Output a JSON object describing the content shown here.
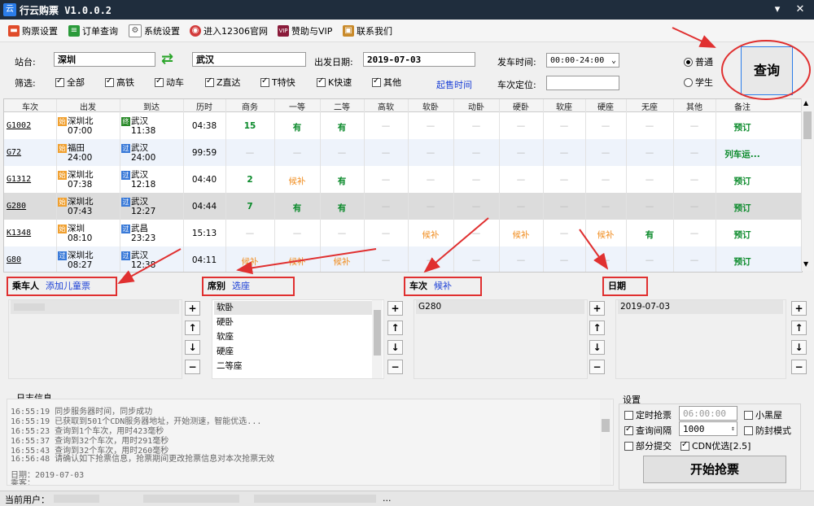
{
  "window": {
    "title": "行云购票 V1.0.0.2",
    "logo": "云",
    "min": "▾",
    "close": "✕"
  },
  "toolbar": [
    {
      "label": "购票设置",
      "icon": "ticket-icon",
      "color": "#e04b2a"
    },
    {
      "label": "订单查询",
      "icon": "order-icon",
      "color": "#2a9a3a"
    },
    {
      "label": "系统设置",
      "icon": "gear-icon",
      "color": "#666666"
    },
    {
      "label": "进入12306官网",
      "icon": "globe-icon",
      "color": "#d23a3a"
    },
    {
      "label": "赞助与VIP",
      "icon": "vip-icon",
      "color": "#8a1b3a"
    },
    {
      "label": "联系我们",
      "icon": "contact-icon",
      "color": "#c98a2a"
    }
  ],
  "search": {
    "station_label": "站台:",
    "from": "深圳",
    "to": "武汉",
    "swap_icon": "⇄",
    "date_label": "出发日期:",
    "date": "2019-07-03",
    "time_label": "发车时间:",
    "time": "00:00-24:00",
    "filter_label": "筛选:",
    "filters": [
      "全部",
      "高铁",
      "动车",
      "Z直达",
      "T特快",
      "K快速",
      "其他"
    ],
    "presale_link": "起售时间",
    "locate_label": "车次定位:",
    "mode_normal": "普通",
    "mode_student": "学生",
    "query_button": "查询"
  },
  "table": {
    "headers": [
      "车次",
      "出发",
      "到达",
      "历时",
      "商务",
      "一等",
      "二等",
      "高软",
      "软卧",
      "动卧",
      "硬卧",
      "软座",
      "硬座",
      "无座",
      "其他",
      "备注"
    ],
    "rows": [
      {
        "train": "G1002",
        "from_tag": "始",
        "from": "深圳北",
        "dep": "07:00",
        "to_tag": "终",
        "to": "武汉",
        "arr": "11:38",
        "dur": "04:38",
        "seats": [
          "15",
          "有",
          "有",
          "—",
          "—",
          "—",
          "—",
          "—",
          "—",
          "—",
          "—"
        ],
        "note": "预订"
      },
      {
        "train": "G72",
        "from_tag": "始",
        "from": "福田",
        "dep": "24:00",
        "to_tag": "过",
        "to": "武汉",
        "arr": "24:00",
        "dur": "99:59",
        "seats": [
          "—",
          "—",
          "—",
          "—",
          "—",
          "—",
          "—",
          "—",
          "—",
          "—",
          "—"
        ],
        "note": "列车运..."
      },
      {
        "train": "G1312",
        "from_tag": "始",
        "from": "深圳北",
        "dep": "07:38",
        "to_tag": "过",
        "to": "武汉",
        "arr": "12:18",
        "dur": "04:40",
        "seats": [
          "2",
          "候补",
          "有",
          "—",
          "—",
          "—",
          "—",
          "—",
          "—",
          "—",
          "—"
        ],
        "note": "预订"
      },
      {
        "train": "G280",
        "from_tag": "始",
        "from": "深圳北",
        "dep": "07:43",
        "to_tag": "过",
        "to": "武汉",
        "arr": "12:27",
        "dur": "04:44",
        "seats": [
          "7",
          "有",
          "有",
          "—",
          "—",
          "—",
          "—",
          "—",
          "—",
          "—",
          "—"
        ],
        "note": "预订"
      },
      {
        "train": "K1348",
        "from_tag": "始",
        "from": "深圳",
        "dep": "08:10",
        "to_tag": "过",
        "to": "武昌",
        "arr": "23:23",
        "dur": "15:13",
        "seats": [
          "—",
          "—",
          "—",
          "—",
          "候补",
          "—",
          "候补",
          "—",
          "候补",
          "有",
          "—"
        ],
        "note": "预订"
      },
      {
        "train": "G80",
        "from_tag": "过",
        "from": "深圳北",
        "dep": "08:27",
        "to_tag": "过",
        "to": "武汉",
        "arr": "12:38",
        "dur": "04:11",
        "seats": [
          "候补",
          "候补",
          "候补",
          "—",
          "—",
          "—",
          "—",
          "—",
          "—",
          "—",
          "—"
        ],
        "note": "预订"
      }
    ]
  },
  "panels": {
    "passenger": {
      "title": "乘车人",
      "link": "添加儿童票"
    },
    "seat": {
      "title": "席别",
      "link": "选座",
      "items": [
        "软卧",
        "硬卧",
        "软座",
        "硬座",
        "二等座"
      ]
    },
    "train": {
      "title": "车次",
      "link": "候补",
      "items": [
        "G280"
      ]
    },
    "date": {
      "title": "日期",
      "items": [
        "2019-07-03"
      ]
    }
  },
  "log": {
    "title": "日志信息",
    "lines": [
      "16:55:19 同步服务器时间，同步成功",
      "16:55:19 已获取到501个CDN服务器地址，开始测速，智能优选...",
      "16:55:23 查询到1个车次，用时423毫秒",
      "16:55:37 查询到32个车次，用时291毫秒",
      "16:55:43 查询到32个车次，用时260毫秒",
      "16:56:48 请确认如下抢票信息，抢票期间更改抢票信息对本次抢票无效",
      "",
      "日期：2019-07-03",
      "乘客："
    ]
  },
  "settings": {
    "title": "设置",
    "timed": "定时抢票",
    "timed_value": "06:00:00",
    "black_room": "小黑屋",
    "interval": "查询间隔",
    "interval_value": "1000",
    "anti_block": "防封模式",
    "partial": "部分提交",
    "cdn": "CDN优选[2.5]",
    "start_button": "开始抢票"
  },
  "status": {
    "user_label": "当前用户：",
    "dots": "..."
  },
  "colors": {
    "accent": "#2b7de9",
    "annotation": "#e03030",
    "available": "#0b8a2b",
    "waitlist": "#f08c1e"
  }
}
